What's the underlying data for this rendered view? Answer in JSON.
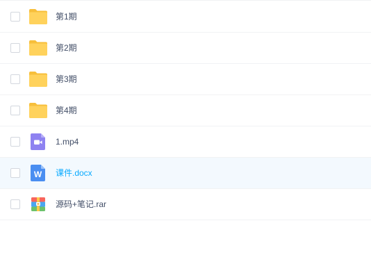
{
  "files": [
    {
      "name": "第1期",
      "type": "folder",
      "icon": "folder-icon",
      "selected": false
    },
    {
      "name": "第2期",
      "type": "folder",
      "icon": "folder-icon",
      "selected": false
    },
    {
      "name": "第3期",
      "type": "folder",
      "icon": "folder-icon",
      "selected": false
    },
    {
      "name": "第4期",
      "type": "folder",
      "icon": "folder-icon",
      "selected": false
    },
    {
      "name": "1.mp4",
      "type": "video",
      "icon": "video-file-icon",
      "selected": false
    },
    {
      "name": "课件.docx",
      "type": "word",
      "icon": "word-doc-icon",
      "selected": true,
      "word_glyph": "W"
    },
    {
      "name": "源码+笔记.rar",
      "type": "archive",
      "icon": "archive-file-icon",
      "selected": false
    }
  ],
  "colors": {
    "folder": "#ffd25c",
    "folder_tab": "#f7bf3b",
    "video": "#8e82f1",
    "word": "#4a8ef1",
    "selected_text": "#09aaff",
    "selected_bg": "#f3f9fe",
    "text": "#424e67"
  }
}
